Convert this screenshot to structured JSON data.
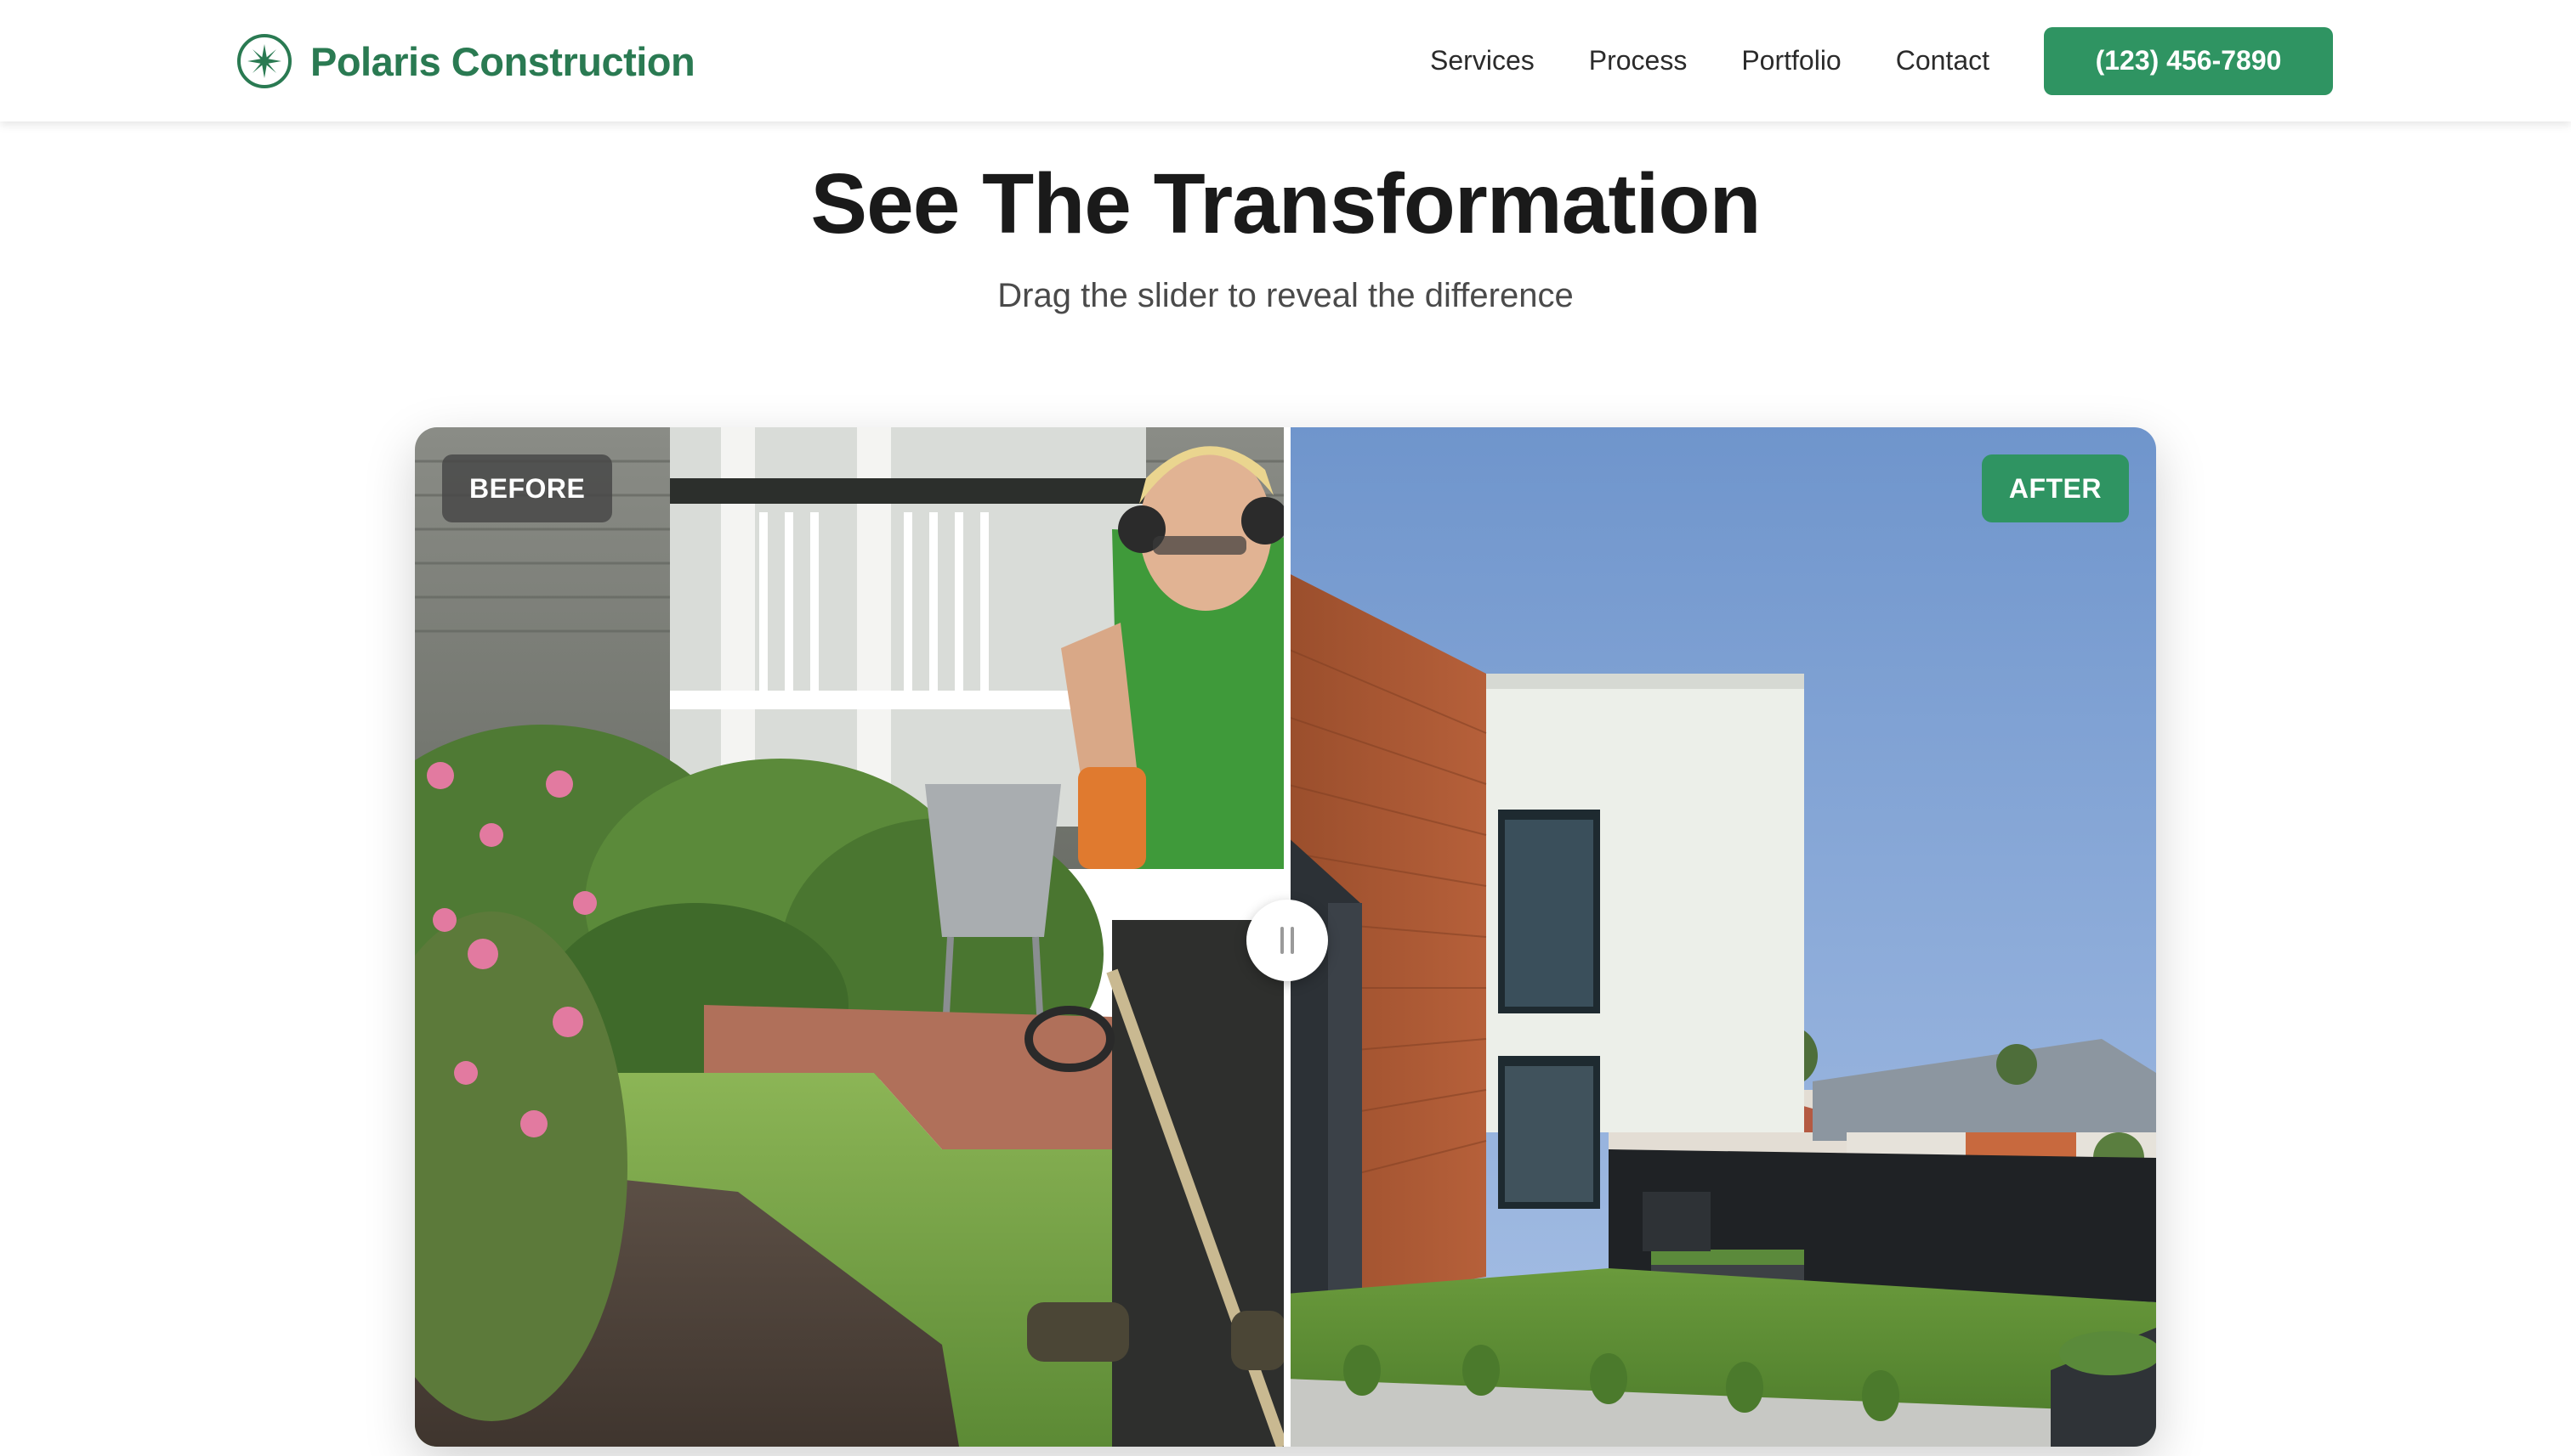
{
  "header": {
    "brand_name": "Polaris Construction",
    "logo_icon": "star-compass-icon",
    "nav": [
      {
        "label": "Services"
      },
      {
        "label": "Process"
      },
      {
        "label": "Portfolio"
      },
      {
        "label": "Contact"
      }
    ],
    "phone_label": "(123) 456-7890"
  },
  "section": {
    "title": "See The Transformation",
    "subtitle": "Drag the slider to reveal the difference"
  },
  "comparison": {
    "before_label": "BEFORE",
    "after_label": "AFTER",
    "slider_position_percent": 50
  },
  "colors": {
    "brand_green": "#2a7a52",
    "button_green": "#2f9462",
    "heading": "#1a1a1a",
    "before_badge": "#464646"
  }
}
